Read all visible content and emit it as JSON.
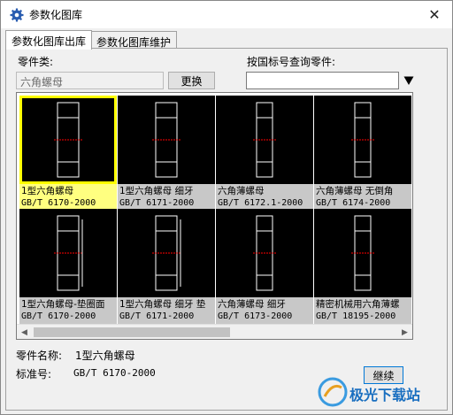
{
  "window": {
    "title": "参数化图库",
    "close_glyph": "✕"
  },
  "tabs": [
    {
      "label": "参数化图库出库",
      "active": true
    },
    {
      "label": "参数化图库维护",
      "active": false
    }
  ],
  "part_type": {
    "label": "零件类:",
    "value": "六角螺母",
    "button": "更换"
  },
  "query": {
    "label": "按国标号查询零件:",
    "value": ""
  },
  "cards": [
    {
      "name": "1型六角螺母",
      "code": "GB/T 6170-2000",
      "selected": true
    },
    {
      "name": "1型六角螺母 细牙",
      "code": "GB/T 6171-2000",
      "selected": false
    },
    {
      "name": "六角薄螺母",
      "code": "GB/T 6172.1-2000",
      "selected": false
    },
    {
      "name": "六角薄螺母 无倒角",
      "code": "GB/T 6174-2000",
      "selected": false
    },
    {
      "name": "1型六角螺母-垫圈面",
      "code": "GB/T 6170-2000",
      "selected": false
    },
    {
      "name": "1型六角螺母 细牙 垫",
      "code": "GB/T 6171-2000",
      "selected": false
    },
    {
      "name": "六角薄螺母 细牙",
      "code": "GB/T 6173-2000",
      "selected": false
    },
    {
      "name": "精密机械用六角薄螺",
      "code": "GB/T 18195-2000",
      "selected": false
    }
  ],
  "details": {
    "name_label": "零件名称:",
    "name_value": "1型六角螺母",
    "std_label": "标准号:",
    "std_value": "GB/T 6170-2000"
  },
  "continue_button": "继续",
  "watermark": "极光下载站",
  "colors": {
    "selected_caption": "#ffff80",
    "selected_border": "#ffff00",
    "drawing_bg": "#000000",
    "centerline": "#ff0000"
  }
}
